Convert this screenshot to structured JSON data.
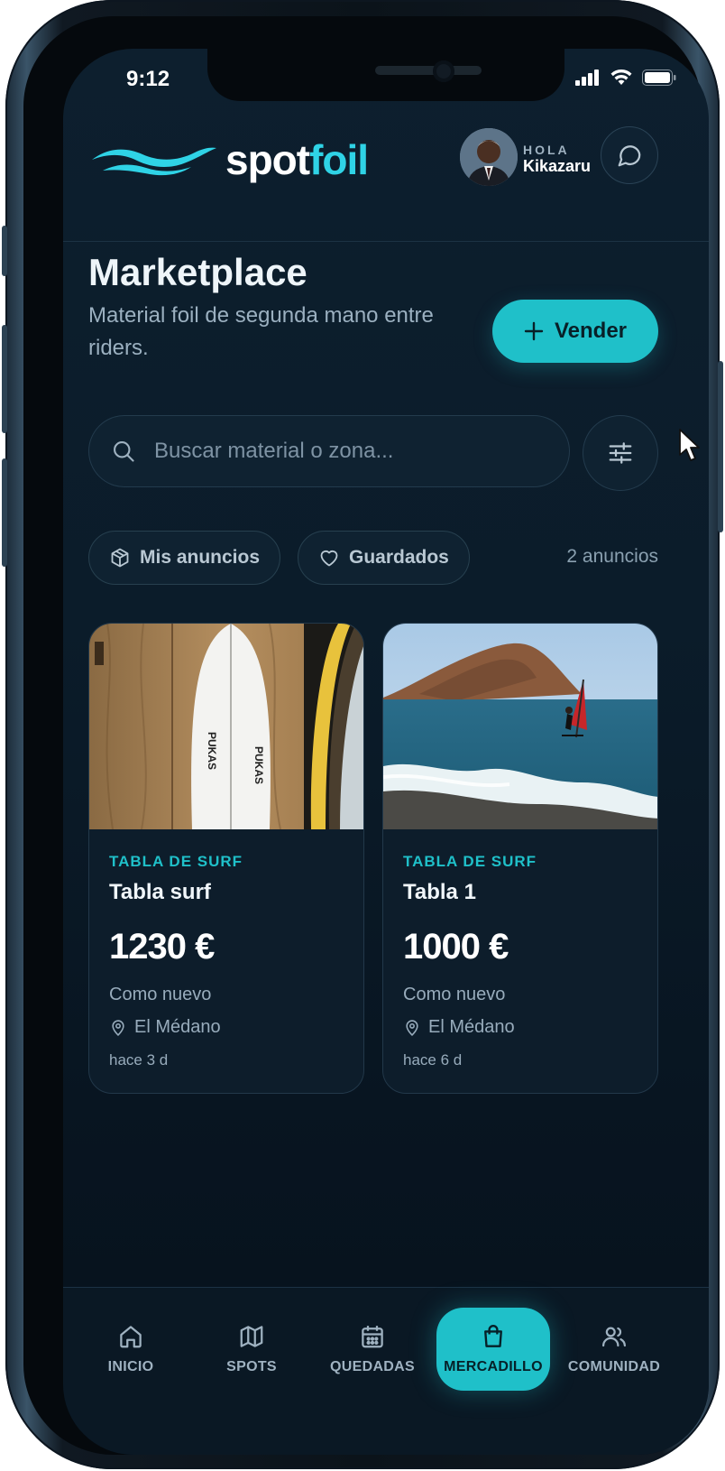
{
  "status": {
    "time": "9:12"
  },
  "brand": {
    "part1": "spot",
    "part2": "foil"
  },
  "user": {
    "greeting": "HOLA",
    "name": "Kikazaru"
  },
  "page": {
    "title": "Marketplace",
    "subtitle": "Material foil de segunda mano entre riders.",
    "sell_label": "Vender"
  },
  "search": {
    "placeholder": "Buscar material o zona..."
  },
  "chips": {
    "mine": "Mis anuncios",
    "saved": "Guardados"
  },
  "results": {
    "count": "2 anuncios"
  },
  "listings": [
    {
      "category": "TABLA DE SURF",
      "title": "Tabla surf",
      "price": "1230 €",
      "condition": "Como nuevo",
      "location": "El Médano",
      "age": "hace 3 d"
    },
    {
      "category": "TABLA DE SURF",
      "title": "Tabla 1",
      "price": "1000 €",
      "condition": "Como nuevo",
      "location": "El Médano",
      "age": "hace 6 d"
    }
  ],
  "nav": [
    {
      "label": "INICIO",
      "icon": "home-icon",
      "active": false
    },
    {
      "label": "SPOTS",
      "icon": "map-icon",
      "active": false
    },
    {
      "label": "QUEDADAS",
      "icon": "calendar-icon",
      "active": false
    },
    {
      "label": "MERCADILLO",
      "icon": "shopping-bag-icon",
      "active": true
    },
    {
      "label": "COMUNIDAD",
      "icon": "users-icon",
      "active": false
    }
  ],
  "colors": {
    "accent": "#1fc0c9",
    "brand_cyan": "#2fd3e6",
    "background": "#0b1c2a"
  }
}
